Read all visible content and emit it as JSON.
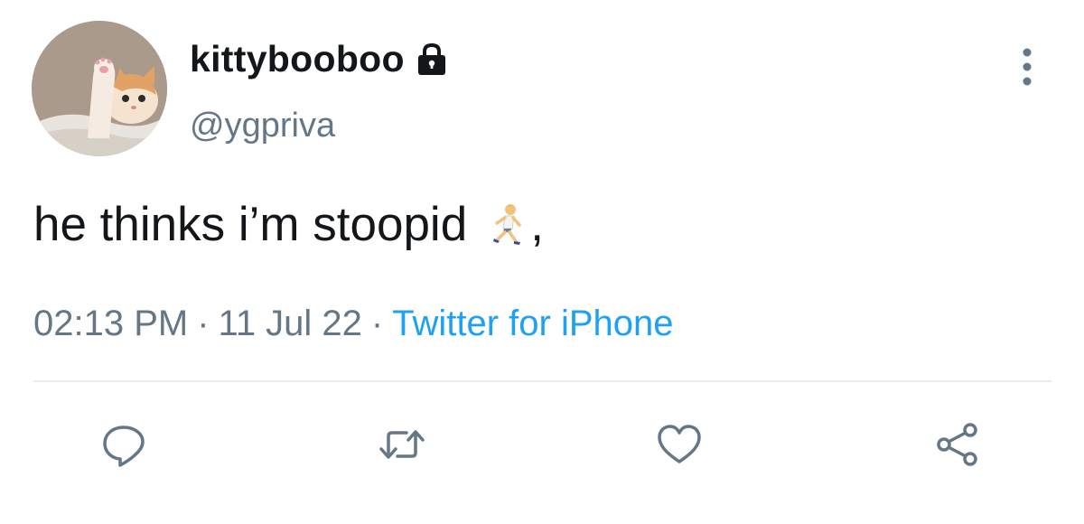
{
  "user": {
    "display_name": "kittybooboo",
    "handle": "@ygpriva",
    "protected_icon": "lock-icon",
    "avatar": "cat-avatar"
  },
  "tweet": {
    "text": "he thinks i’m stoopid",
    "emoji": "runner-icon"
  },
  "meta": {
    "time": "02:13 PM",
    "separator": "·",
    "date": "11 Jul 22",
    "source": "Twitter for iPhone"
  },
  "actions": [
    "reply-icon",
    "retweet-icon",
    "like-icon",
    "share-icon"
  ],
  "colors": {
    "text": "#14171a",
    "secondary": "#657786",
    "link": "#1da1f2",
    "divider": "#e6ecf0"
  }
}
